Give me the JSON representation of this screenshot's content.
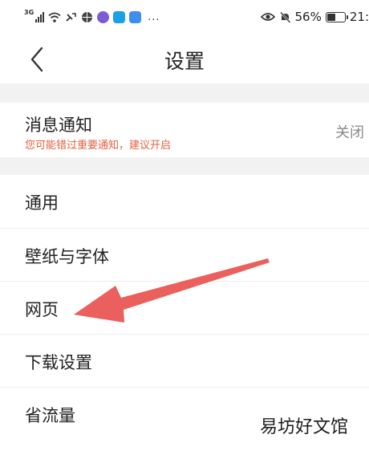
{
  "status_bar": {
    "network": "3G",
    "battery_text": "56%",
    "battery_level": 0.56,
    "time_partial": "21:",
    "overflow": "..."
  },
  "nav": {
    "title": "设置",
    "back_icon": "chevron-left-icon"
  },
  "notification": {
    "title": "消息通知",
    "subtitle": "您可能错过重要通知，建议开启",
    "value": "关闭"
  },
  "menu": {
    "items": [
      {
        "label": "通用"
      },
      {
        "label": "壁纸与字体"
      },
      {
        "label": "网页"
      },
      {
        "label": "下载设置"
      },
      {
        "label": "省流量"
      }
    ]
  },
  "annotation": {
    "arrow_color": "#e8524f",
    "arrow_target": "网页"
  },
  "watermark": "易坊好文馆",
  "colors": {
    "hint_text": "#e5603f",
    "section_gap": "#f2f2f2",
    "secondary_text": "#888888"
  }
}
